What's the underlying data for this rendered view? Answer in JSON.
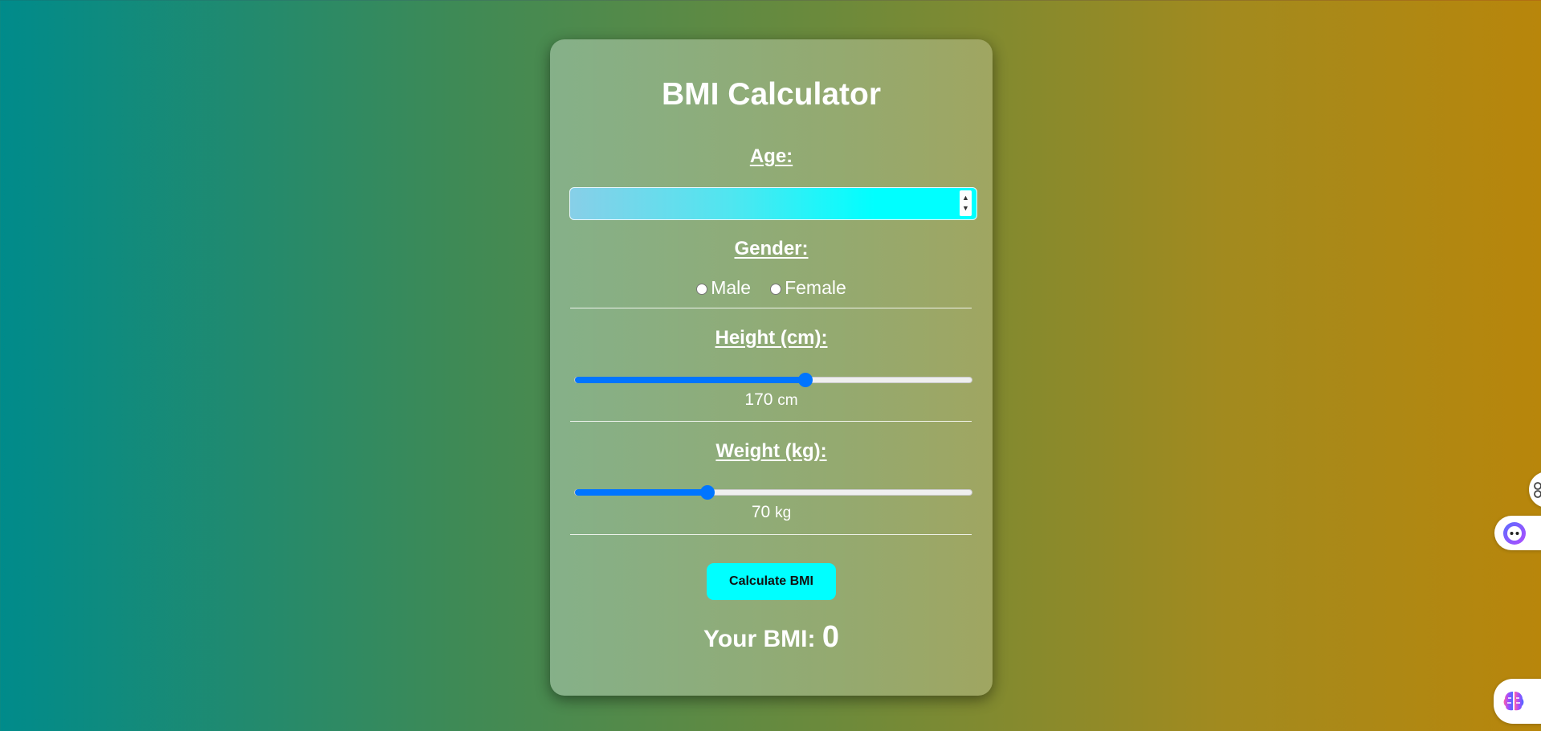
{
  "page": {
    "background_colors": [
      "#008b8b",
      "#6e8a3a",
      "#b8860b"
    ]
  },
  "card": {
    "title": "BMI Calculator",
    "age": {
      "label": "Age:",
      "value": "",
      "placeholder": ""
    },
    "gender": {
      "label": "Gender:",
      "options": [
        {
          "label": "Male",
          "selected": false
        },
        {
          "label": "Female",
          "selected": false
        }
      ]
    },
    "height": {
      "label": "Height (cm):",
      "value": "170",
      "unit": "cm",
      "fraction": 0.58
    },
    "weight": {
      "label": "Weight (kg):",
      "value": "70",
      "unit": "kg",
      "fraction": 0.335
    },
    "calculate_button": "Calculate BMI",
    "result": {
      "label": "Your BMI:",
      "value": "0"
    },
    "accent_colors": {
      "button": "#00ffff",
      "slider": "#0075ff"
    }
  },
  "floating_widgets": [
    {
      "icon": "apps-grid-icon"
    },
    {
      "icon": "assistant-bot-icon"
    },
    {
      "icon": "brain-icon"
    }
  ]
}
